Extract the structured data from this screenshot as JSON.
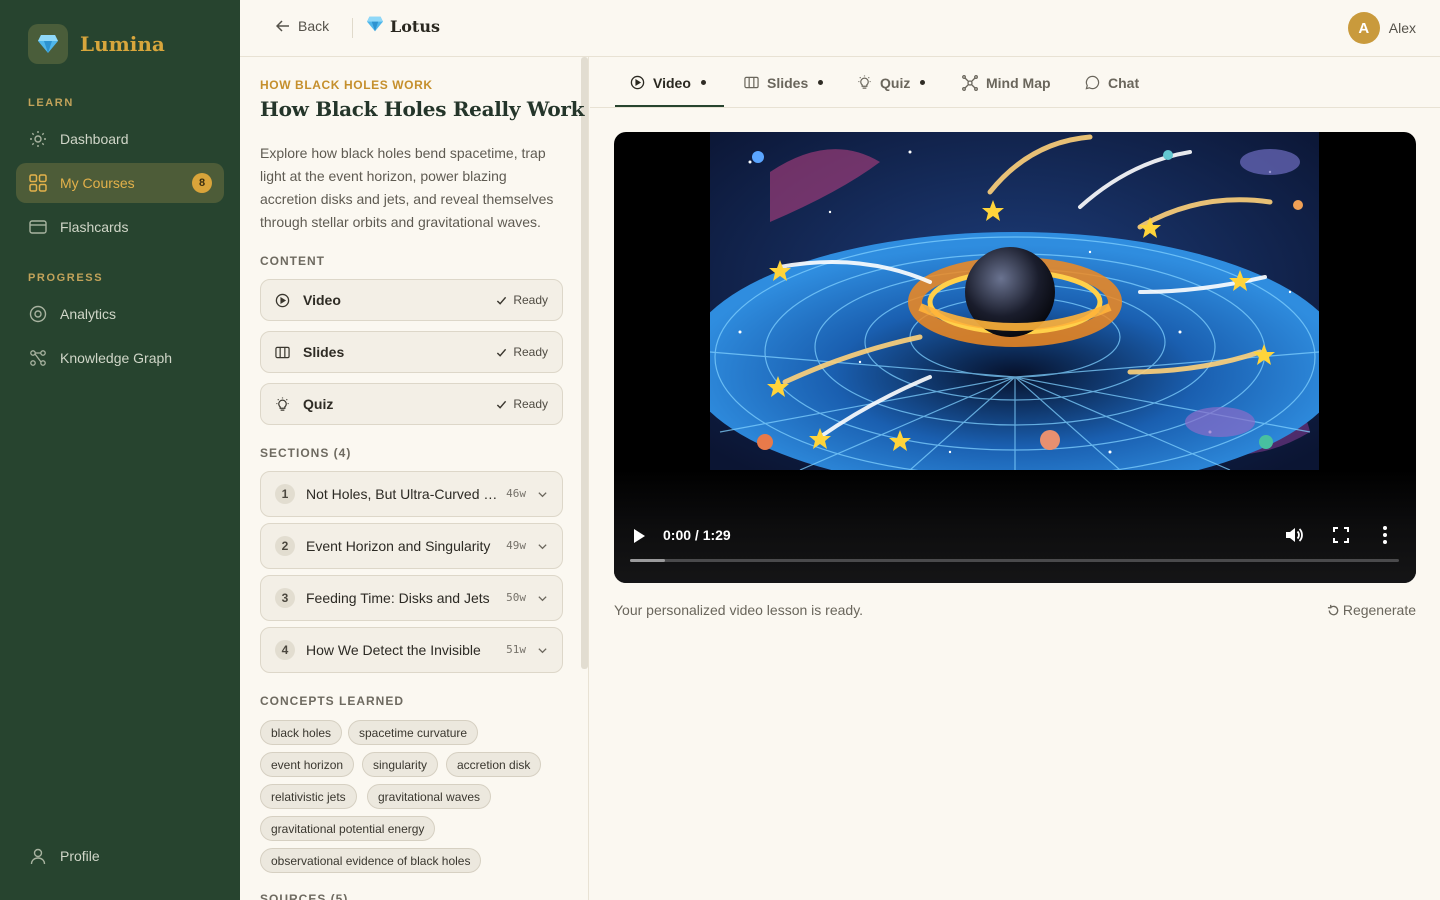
{
  "app": {
    "name": "Lumina",
    "logo_icon": "gem-icon"
  },
  "sidebar": {
    "sections": [
      {
        "label": "LEARN"
      },
      {
        "label": "PROGRESS"
      }
    ],
    "items": [
      {
        "label": "Dashboard",
        "icon": "sun-icon"
      },
      {
        "label": "My Courses",
        "icon": "grid-icon",
        "badge": "8",
        "active": true
      },
      {
        "label": "Flashcards",
        "icon": "card-icon"
      },
      {
        "label": "Analytics",
        "icon": "target-icon"
      },
      {
        "label": "Knowledge Graph",
        "icon": "graph-icon"
      }
    ],
    "profile": {
      "label": "Profile",
      "icon": "user-icon"
    }
  },
  "topbar": {
    "back_label": "Back",
    "title": "Lotus",
    "user": {
      "initial": "A",
      "name": "Alex"
    }
  },
  "course": {
    "kicker": "HOW BLACK HOLES WORK",
    "title": "How Black Holes Really Work",
    "description": "Explore how black holes bend spacetime, trap light at the event horizon, power blazing accretion disks and jets, and reveal themselves through stellar orbits and gravitational waves.",
    "content_label": "CONTENT",
    "content": [
      {
        "label": "Video",
        "status": "Ready",
        "icon": "play-circle-icon"
      },
      {
        "label": "Slides",
        "status": "Ready",
        "icon": "slides-icon"
      },
      {
        "label": "Quiz",
        "status": "Ready",
        "icon": "lightbulb-icon"
      }
    ],
    "sections_label": "SECTIONS (4)",
    "sections": [
      {
        "num": "1",
        "title": "Not Holes, But Ultra-Curved Spacetime",
        "words": "46w"
      },
      {
        "num": "2",
        "title": "Event Horizon and Singularity",
        "words": "49w"
      },
      {
        "num": "3",
        "title": "Feeding Time: Disks and Jets",
        "words": "50w"
      },
      {
        "num": "4",
        "title": "How We Detect the Invisible",
        "words": "51w"
      }
    ],
    "concepts_label": "CONCEPTS LEARNED",
    "concepts": [
      "black holes",
      "spacetime curvature",
      "event horizon",
      "singularity",
      "accretion disk",
      "relativistic jets",
      "gravitational waves",
      "gravitational potential energy",
      "observational evidence of black holes"
    ],
    "sources_label": "SOURCES (5)"
  },
  "tabs": [
    {
      "label": "Video",
      "icon": "play-circle-icon",
      "dot": true,
      "active": true
    },
    {
      "label": "Slides",
      "icon": "slides-icon",
      "dot": true
    },
    {
      "label": "Quiz",
      "icon": "lightbulb-icon",
      "dot": true
    },
    {
      "label": "Mind Map",
      "icon": "mindmap-icon",
      "dot": false
    },
    {
      "label": "Chat",
      "icon": "chat-icon",
      "dot": false
    }
  ],
  "video": {
    "time": "0:00 / 1:29",
    "buffered_fraction": 0.045,
    "status_text": "Your personalized video lesson is ready.",
    "regenerate_label": "Regenerate"
  },
  "colors": {
    "sidebar_bg": "#27442f",
    "accent": "#d9a43a",
    "page_bg": "#fbf8f1"
  }
}
